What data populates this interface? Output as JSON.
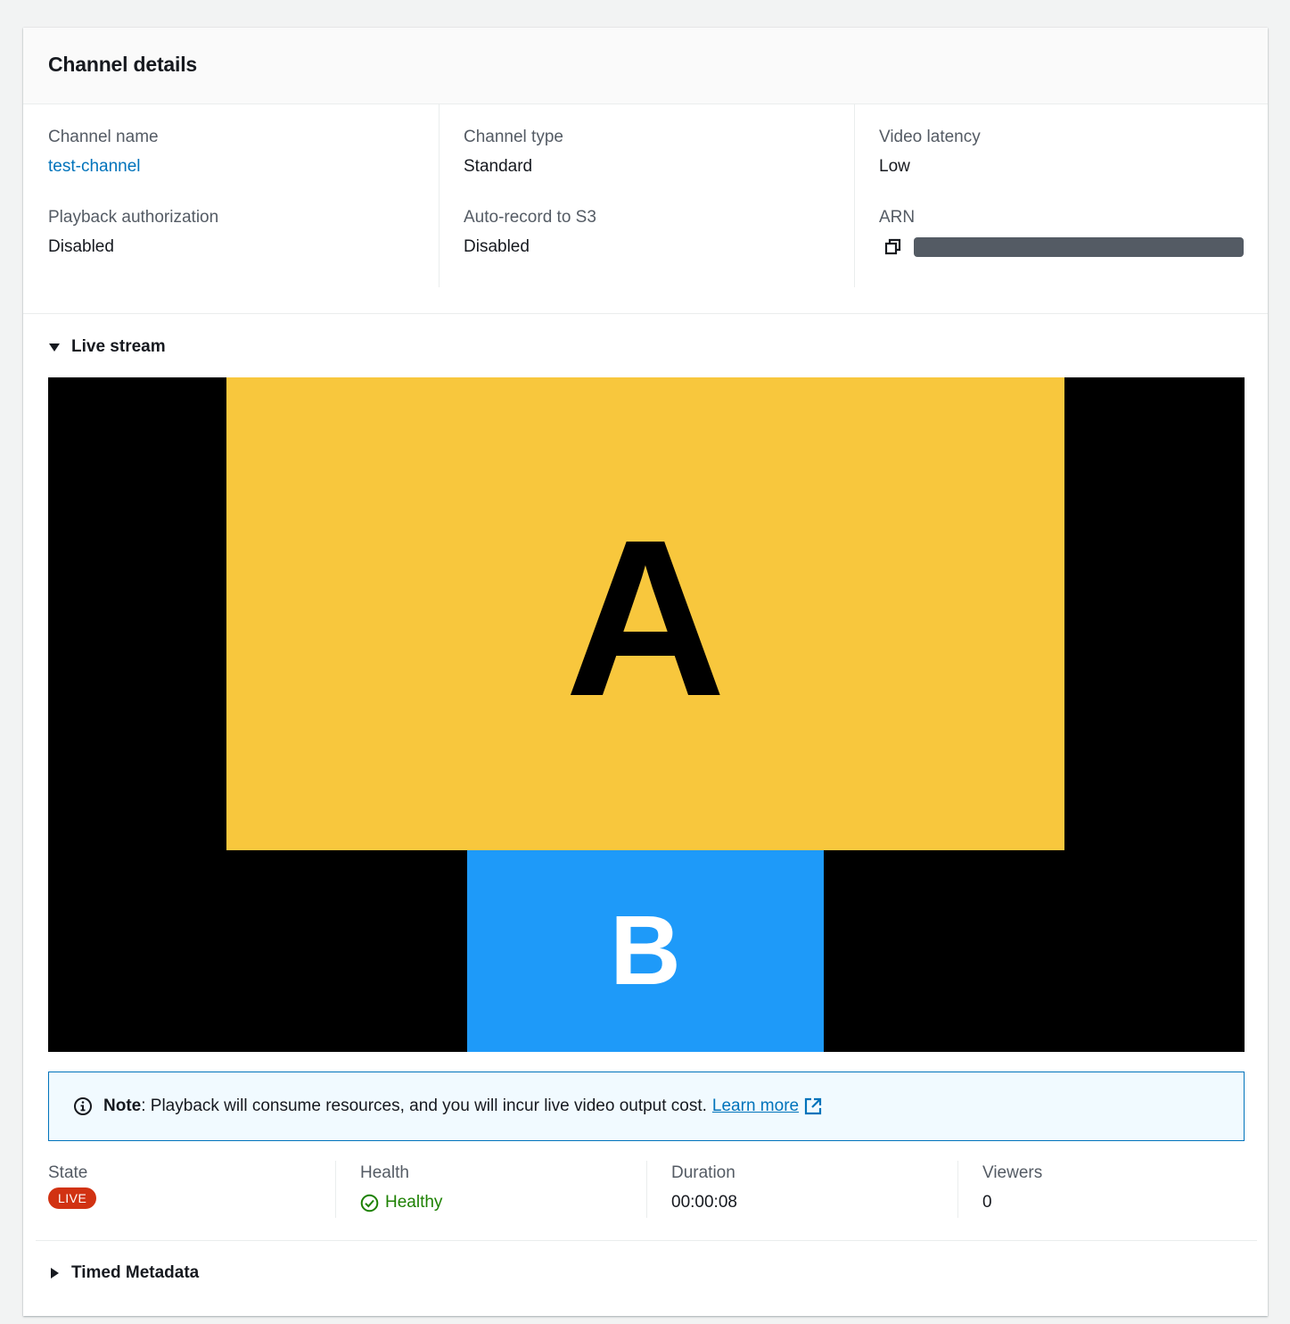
{
  "panel": {
    "title": "Channel details"
  },
  "details": {
    "channel_name": {
      "label": "Channel name",
      "value": "test-channel"
    },
    "playback_authorization": {
      "label": "Playback authorization",
      "value": "Disabled"
    },
    "channel_type": {
      "label": "Channel type",
      "value": "Standard"
    },
    "auto_record": {
      "label": "Auto-record to S3",
      "value": "Disabled"
    },
    "video_latency": {
      "label": "Video latency",
      "value": "Low"
    },
    "arn": {
      "label": "ARN",
      "copy_icon": "copy-icon",
      "value_redacted": true
    }
  },
  "live_stream": {
    "label": "Live stream",
    "expanded": true,
    "video": {
      "tile_a": {
        "letter": "A",
        "color": "#f8c73d"
      },
      "tile_b": {
        "letter": "B",
        "color": "#1e9af9"
      }
    }
  },
  "note": {
    "title": "Note",
    "text": ": Playback will consume resources, and you will incur live video output cost.",
    "link": "Learn more",
    "icon": "info-icon",
    "link_icon": "external-link-icon"
  },
  "stats": {
    "state": {
      "label": "State",
      "value": "LIVE"
    },
    "health": {
      "label": "Health",
      "value": "Healthy",
      "icon": "status-positive-icon"
    },
    "duration": {
      "label": "Duration",
      "value": "00:00:08"
    },
    "viewers": {
      "label": "Viewers",
      "value": "0"
    }
  },
  "timed_metadata": {
    "label": "Timed Metadata",
    "expanded": false
  },
  "colors": {
    "link": "#0073bb",
    "live_badge": "#d13212",
    "healthy": "#1d8102",
    "note_border": "#0073bb",
    "note_background": "#f1faff"
  }
}
